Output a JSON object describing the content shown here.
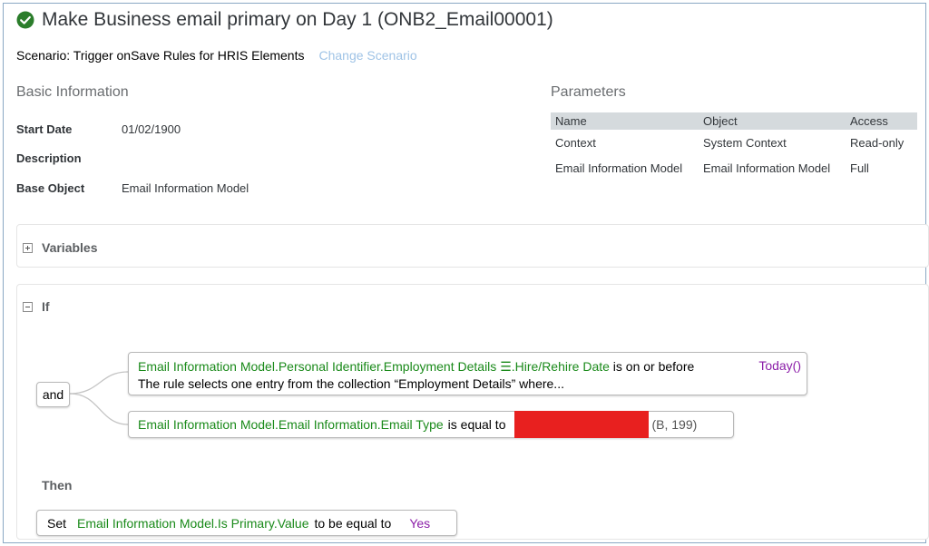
{
  "title": "Make Business email primary on Day 1 (ONB2_Email00001)",
  "status_icon": "check-circle-icon",
  "accent_green": "#2b7d2b",
  "scenario": {
    "text": "Scenario: Trigger onSave Rules for HRIS Elements",
    "change_link": "Change Scenario"
  },
  "basic_info": {
    "heading": "Basic Information",
    "fields": [
      {
        "label": "Start Date",
        "value": "01/02/1900"
      },
      {
        "label": "Description",
        "value": ""
      },
      {
        "label": "Base Object",
        "value": "Email Information Model"
      }
    ]
  },
  "parameters": {
    "heading": "Parameters",
    "columns": [
      "Name",
      "Object",
      "Access"
    ],
    "rows": [
      [
        "Context",
        "System Context",
        "Read-only"
      ],
      [
        "Email Information Model",
        "Email Information Model",
        "Full"
      ]
    ]
  },
  "variables": {
    "label": "Variables",
    "toggle_icon": "expand-plus-icon"
  },
  "if_section": {
    "label": "If",
    "toggle_icon": "collapse-minus-icon",
    "operator": "and",
    "condition1": {
      "field_prefix": "Email Information Model.Personal Identifier.Employment Details ",
      "collection_icon": "☰",
      "field_suffix": ".Hire/Rehire Date",
      "comparator": "is on or before",
      "value": "Today()",
      "note": "The rule selects one entry from the collection “Employment Details” where..."
    },
    "condition2": {
      "field": "Email Information Model.Email Information.Email Type",
      "comparator": "is equal to",
      "value_suffix": "(B, 199)"
    }
  },
  "then_section": {
    "label": "Then",
    "action": {
      "verb": "Set",
      "field": "Email Information Model.Is Primary.Value",
      "comparator": "to be equal to",
      "value": "Yes"
    }
  }
}
